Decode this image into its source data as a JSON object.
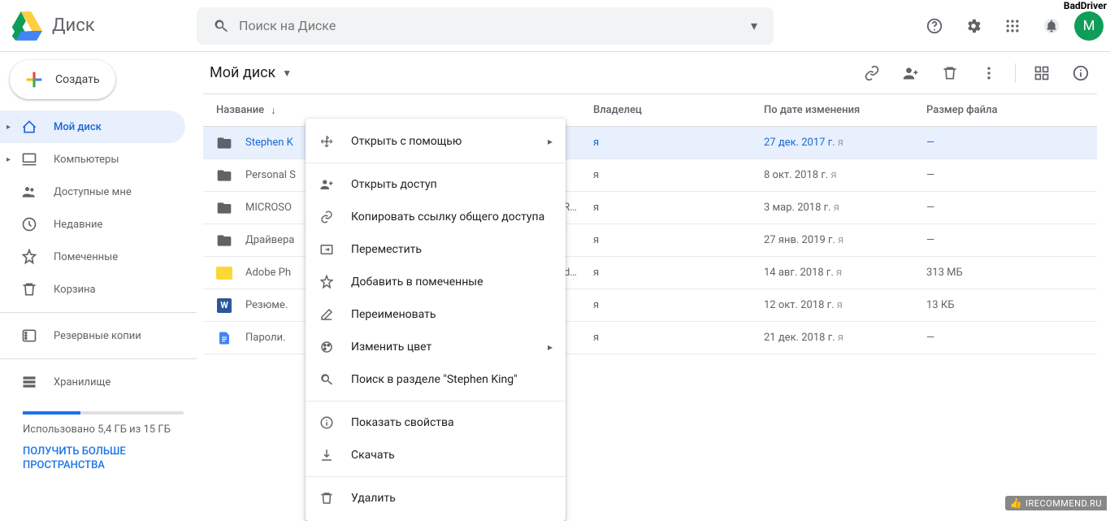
{
  "user_label": "BadDriver",
  "header": {
    "product": "Диск",
    "search_placeholder": "Поиск на Диске",
    "avatar_letter": "M"
  },
  "sidebar": {
    "new_button": "Создать",
    "items": [
      {
        "label": "Мой диск",
        "active": true,
        "expandable": true
      },
      {
        "label": "Компьютеры",
        "active": false,
        "expandable": true
      },
      {
        "label": "Доступные мне",
        "active": false
      },
      {
        "label": "Недавние",
        "active": false
      },
      {
        "label": "Помеченные",
        "active": false
      },
      {
        "label": "Корзина",
        "active": false
      }
    ],
    "backups": "Резервные копии",
    "storage_title": "Хранилище",
    "storage_used": "Использовано 5,4 ГБ из 15 ГБ",
    "storage_link": "ПОЛУЧИТЬ БОЛЬШЕ ПРОСТРАНСТВА"
  },
  "path": {
    "title": "Мой диск"
  },
  "columns": {
    "name": "Название",
    "owner": "Владелец",
    "date": "По дате изменения",
    "size": "Размер файла"
  },
  "files": [
    {
      "name": "Stephen K",
      "owner": "я",
      "date": "27 дек. 2017 г.",
      "by": "я",
      "size": "—",
      "type": "folder",
      "selected": true
    },
    {
      "name": "Personal S",
      "owner": "я",
      "date": "8 окт. 2018 г.",
      "by": "я",
      "size": "—",
      "type": "folder"
    },
    {
      "name": "MICROSO",
      "owner": "я",
      "date": "3 мар. 2018 г.",
      "by": "я",
      "size": "—",
      "type": "folder",
      "trunc": "KR…"
    },
    {
      "name": "Драйвера",
      "owner": "я",
      "date": "27 янв. 2019 г.",
      "by": "я",
      "size": "—",
      "type": "folder"
    },
    {
      "name": "Adobe Ph",
      "owner": "я",
      "date": "14 авг. 2018 г.",
      "by": "я",
      "size": "313 МБ",
      "type": "zip",
      "trunc": "d…"
    },
    {
      "name": "Резюме.",
      "owner": "я",
      "date": "12 окт. 2018 г.",
      "by": "я",
      "size": "13 КБ",
      "type": "word"
    },
    {
      "name": "Пароли.",
      "owner": "я",
      "date": "21 дек. 2018 г.",
      "by": "я",
      "size": "—",
      "type": "gdoc"
    }
  ],
  "context_menu": [
    {
      "icon": "open",
      "label": "Открыть с помощью",
      "arrow": true
    },
    {
      "sep": true
    },
    {
      "icon": "share",
      "label": "Открыть доступ"
    },
    {
      "icon": "link",
      "label": "Копировать ссылку общего доступа"
    },
    {
      "icon": "move",
      "label": "Переместить"
    },
    {
      "icon": "star",
      "label": "Добавить в помеченные"
    },
    {
      "icon": "rename",
      "label": "Переименовать"
    },
    {
      "icon": "color",
      "label": "Изменить цвет",
      "arrow": true
    },
    {
      "icon": "search",
      "label": "Поиск в разделе \"Stephen King\""
    },
    {
      "sep": true
    },
    {
      "icon": "info",
      "label": "Показать свойства"
    },
    {
      "icon": "download",
      "label": "Скачать"
    },
    {
      "sep": true
    },
    {
      "icon": "trash",
      "label": "Удалить"
    }
  ],
  "watermark": "IRECOMMEND.RU"
}
